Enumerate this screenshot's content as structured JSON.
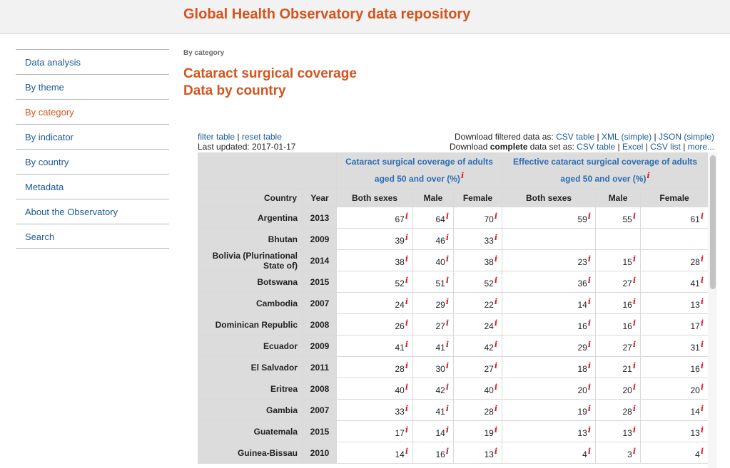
{
  "header": {
    "title": "Global Health Observatory data repository"
  },
  "sidebar": {
    "items": [
      {
        "label": "Data analysis"
      },
      {
        "label": "By theme"
      },
      {
        "label": "By category"
      },
      {
        "label": "By indicator"
      },
      {
        "label": "By country"
      },
      {
        "label": "Metadata"
      },
      {
        "label": "About the Observatory"
      },
      {
        "label": "Search"
      }
    ],
    "active": "By category"
  },
  "breadcrumb": "By category",
  "page": {
    "title_line1": "Cataract surgical coverage",
    "title_line2": "Data by country"
  },
  "toolbar": {
    "filter_table": "filter table",
    "reset_table": "reset table",
    "last_updated": "Last updated: 2017-01-17",
    "download_filtered_prefix": "Download filtered data as:",
    "filtered_links": [
      "CSV table",
      "XML (simple)",
      "JSON (simple)"
    ],
    "download_complete_prefix1": "Download",
    "download_complete_bold": "complete",
    "download_complete_prefix2": "data set as:",
    "complete_links": [
      "CSV table",
      "Excel",
      "CSV list",
      "more..."
    ],
    "separator": "|"
  },
  "table": {
    "group1": "Cataract surgical coverage of adults aged 50 and over (%)",
    "group2": "Effective cataract surgical coverage of adults aged 50 and over (%)",
    "note_marker": "i",
    "columns": [
      "Country",
      "Year",
      "Both sexes",
      "Male",
      "Female",
      "Both sexes",
      "Male",
      "Female"
    ],
    "rows": [
      {
        "country": "Argentina",
        "year": "2013",
        "values": [
          "67",
          "64",
          "70",
          "59",
          "55",
          "61"
        ]
      },
      {
        "country": "Bhutan",
        "year": "2009",
        "values": [
          "39",
          "46",
          "33",
          "",
          "",
          ""
        ]
      },
      {
        "country": "Bolivia (Plurinational State of)",
        "year": "2014",
        "values": [
          "38",
          "40",
          "38",
          "23",
          "15",
          "28"
        ]
      },
      {
        "country": "Botswana",
        "year": "2015",
        "values": [
          "52",
          "51",
          "52",
          "36",
          "27",
          "41"
        ]
      },
      {
        "country": "Cambodia",
        "year": "2007",
        "values": [
          "24",
          "29",
          "22",
          "14",
          "16",
          "13"
        ]
      },
      {
        "country": "Dominican Republic",
        "year": "2008",
        "values": [
          "26",
          "27",
          "24",
          "16",
          "16",
          "17"
        ]
      },
      {
        "country": "Ecuador",
        "year": "2009",
        "values": [
          "41",
          "41",
          "42",
          "29",
          "27",
          "31"
        ]
      },
      {
        "country": "El Salvador",
        "year": "2011",
        "values": [
          "28",
          "30",
          "27",
          "18",
          "21",
          "16"
        ]
      },
      {
        "country": "Eritrea",
        "year": "2008",
        "values": [
          "40",
          "42",
          "40",
          "20",
          "20",
          "20"
        ]
      },
      {
        "country": "Gambia",
        "year": "2007",
        "values": [
          "33",
          "41",
          "28",
          "19",
          "28",
          "14"
        ]
      },
      {
        "country": "Guatemala",
        "year": "2015",
        "values": [
          "17",
          "14",
          "19",
          "13",
          "13",
          "13"
        ]
      },
      {
        "country": "Guinea-Bissau",
        "year": "2010",
        "values": [
          "14",
          "16",
          "13",
          "4",
          "3",
          "4"
        ]
      }
    ]
  }
}
